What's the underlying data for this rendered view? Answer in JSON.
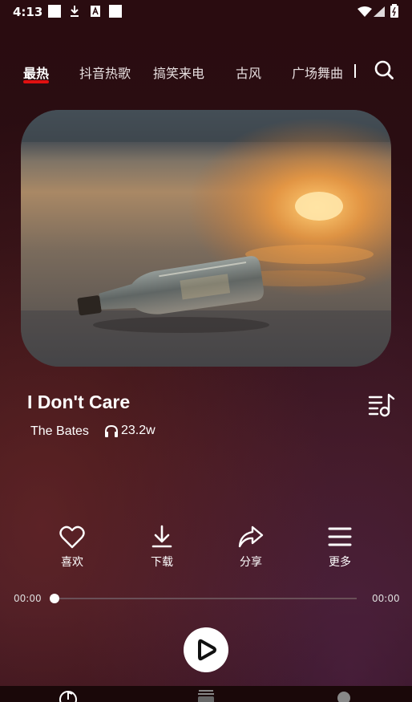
{
  "status_bar": {
    "time": "4:13"
  },
  "tabs": [
    {
      "label": "最热",
      "active": true
    },
    {
      "label": "抖音热歌",
      "active": false
    },
    {
      "label": "搞笑来电",
      "active": false
    },
    {
      "label": "古风",
      "active": false
    },
    {
      "label": "广场舞曲",
      "active": false
    }
  ],
  "song": {
    "title": "I Don't Care",
    "artist": "The Bates",
    "plays": "23.2w"
  },
  "actions": [
    {
      "label": "喜欢",
      "icon": "heart-icon"
    },
    {
      "label": "下载",
      "icon": "download-icon"
    },
    {
      "label": "分享",
      "icon": "share-icon"
    },
    {
      "label": "更多",
      "icon": "menu-icon"
    }
  ],
  "player": {
    "current_time": "00:00",
    "total_time": "00:00",
    "progress": 0
  },
  "colors": {
    "accent": "#e01010",
    "background": "#2a0c10"
  }
}
